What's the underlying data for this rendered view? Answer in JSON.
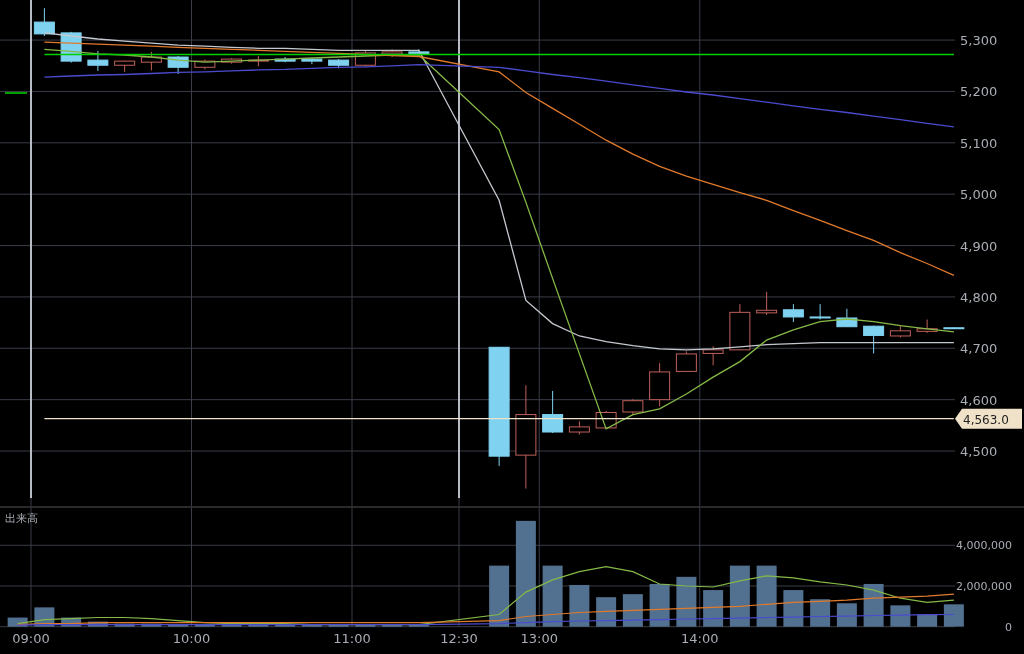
{
  "price_chart": {
    "marker": {
      "color": "#00a000"
    },
    "current_price": {
      "label": "4,563.0",
      "color": "#f0e2c8"
    },
    "chart_data": {
      "type": "candlestick",
      "grid": true,
      "ylim": [
        4393,
        5378
      ],
      "yticks": [
        {
          "value": 4500,
          "label": "4,500"
        },
        {
          "value": 4600,
          "label": "4,600"
        },
        {
          "value": 4700,
          "label": "4,700"
        },
        {
          "value": 4800,
          "label": "4,800"
        },
        {
          "value": 4900,
          "label": "4,900"
        },
        {
          "value": 5000,
          "label": "5,000"
        },
        {
          "value": 5100,
          "label": "5,100"
        },
        {
          "value": 5200,
          "label": "5,200"
        },
        {
          "value": 5300,
          "label": "5,300"
        }
      ],
      "ohlc": [
        [
          5335,
          5362,
          5308,
          5312
        ],
        [
          5314,
          5316,
          5256,
          5259
        ],
        [
          5261,
          5279,
          5240,
          5251
        ],
        [
          5251,
          5260,
          5238,
          5259
        ],
        [
          5257,
          5277,
          5241,
          5267
        ],
        [
          5267,
          5269,
          5234,
          5247
        ],
        [
          5247,
          5262,
          5243,
          5259
        ],
        [
          5257,
          5265,
          5254,
          5263
        ],
        [
          5259,
          5269,
          5249,
          5261
        ],
        [
          5263,
          5267,
          5257,
          5259
        ],
        [
          5263,
          5265,
          5253,
          5259
        ],
        [
          5261,
          5263,
          5245,
          5251
        ],
        [
          5251,
          5280,
          5249,
          5275
        ],
        [
          5273,
          5282,
          5267,
          5277
        ],
        [
          5277,
          5282,
          5270,
          5273
        ],
        null,
        null,
        [
          4702,
          4702,
          4471,
          4490
        ],
        [
          4492,
          4628,
          4427,
          4571
        ],
        [
          4571,
          4617,
          4535,
          4537
        ],
        [
          4537,
          4558,
          4532,
          4547
        ],
        [
          4545,
          4578,
          4544,
          4575
        ],
        [
          4576,
          4601,
          4570,
          4598
        ],
        [
          4600,
          4671,
          4587,
          4654
        ],
        [
          4655,
          4694,
          4655,
          4689
        ],
        [
          4690,
          4704,
          4667,
          4697
        ],
        [
          4697,
          4786,
          4696,
          4770
        ],
        [
          4769,
          4810,
          4765,
          4774
        ],
        [
          4775,
          4786,
          4751,
          4761
        ],
        [
          4761,
          4786,
          4756,
          4759
        ],
        [
          4759,
          4777,
          4742,
          4742
        ],
        [
          4743,
          4744,
          4690,
          4725
        ],
        [
          4724,
          4743,
          4721,
          4734
        ],
        [
          4733,
          4756,
          4730,
          4738
        ],
        [
          4740,
          4741,
          4739,
          4739
        ]
      ],
      "series": [
        {
          "type": "line",
          "color": "#c4c8cf",
          "values": [
            5314,
            5308,
            5302,
            5298,
            5294,
            5290,
            5288,
            5286,
            5284,
            5284,
            5282,
            5280,
            5280,
            5280,
            5280,
            null,
            null,
            4988,
            4793,
            4748,
            4724,
            4713,
            4705,
            4699,
            4697,
            4699,
            4703,
            4707,
            4709,
            4711,
            4711,
            4711,
            4711,
            4711,
            4711
          ]
        },
        {
          "type": "line",
          "color": "#86b947",
          "values": [
            5282,
            5278,
            5273,
            5271,
            5267,
            5261,
            5257,
            5259,
            5261,
            5263,
            5265,
            5267,
            5269,
            5271,
            5271,
            null,
            null,
            5126,
            4984,
            4836,
            4689,
            4543,
            4571,
            4582,
            4611,
            4644,
            4674,
            4716,
            4736,
            4752,
            4757,
            4752,
            4744,
            4738,
            4732
          ]
        },
        {
          "type": "line",
          "color": "#e07a2c",
          "values": [
            5296,
            5294,
            5292,
            5290,
            5288,
            5286,
            5284,
            5282,
            5280,
            5278,
            5276,
            5274,
            5272,
            5270,
            5268,
            null,
            null,
            5238,
            5198,
            5167,
            5136,
            5105,
            5078,
            5054,
            5035,
            5019,
            5003,
            4988,
            4968,
            4949,
            4929,
            4910,
            4886,
            4865,
            4842
          ]
        },
        {
          "type": "line",
          "color": "#4b4bd0",
          "values": [
            5228,
            5230,
            5232,
            5233,
            5235,
            5237,
            5238,
            5240,
            5242,
            5243,
            5245,
            5247,
            5248,
            5250,
            5252,
            null,
            null,
            5247,
            5240,
            5233,
            5227,
            5220,
            5213,
            5206,
            5199,
            5193,
            5186,
            5179,
            5172,
            5165,
            5159,
            5152,
            5145,
            5138,
            5131
          ]
        },
        {
          "type": "line",
          "color": "#00d000",
          "values": [
            5272,
            5272,
            5272,
            5272,
            5272,
            5272,
            5272,
            5272,
            5272,
            5272,
            5272,
            5272,
            5272,
            5272,
            5272,
            5272,
            5272,
            5272,
            5272,
            5272,
            5272,
            5272,
            5272,
            5272,
            5272,
            5272,
            5272,
            5272,
            5272,
            5272,
            5272,
            5272,
            5272,
            5272,
            5272
          ]
        },
        {
          "type": "line",
          "color": "#f0e2c8",
          "values": [
            4563,
            4563,
            4563,
            4563,
            4563,
            4563,
            4563,
            4563,
            4563,
            4563,
            4563,
            4563,
            4563,
            4563,
            4563,
            4563,
            4563,
            4563,
            4563,
            4563,
            4563,
            4563,
            4563,
            4563,
            4563,
            4563,
            4563,
            4563,
            4563,
            4563,
            4563,
            4563,
            4563,
            4563,
            4563
          ]
        }
      ]
    }
  },
  "time_axis": [
    {
      "label": "09:00"
    },
    {
      "label": "10:00"
    },
    {
      "label": "11:00"
    },
    {
      "label": "12:30"
    },
    {
      "label": "13:00"
    },
    {
      "label": "14:00"
    }
  ],
  "volume_chart": {
    "chart_data": {
      "type": "bar",
      "grid": true,
      "title": "出来高",
      "ylim": [
        0,
        5930000
      ],
      "yticks": [
        {
          "value": 0,
          "label": "0"
        },
        {
          "value": 2000000,
          "label": "2,000,000"
        },
        {
          "value": 4000000,
          "label": "4,000,000"
        }
      ],
      "series": [
        {
          "color": "#52708f",
          "values": [
            450000,
            950000,
            450000,
            250000,
            150000,
            150000,
            100000,
            100000,
            100000,
            100000,
            100000,
            100000,
            100000,
            100000,
            100000,
            100000,
            null,
            null,
            3000000,
            5200000,
            3000000,
            2050000,
            1450000,
            1600000,
            2100000,
            2450000,
            1800000,
            3000000,
            3000000,
            1800000,
            1350000,
            1150000,
            2100000,
            1050000,
            600000,
            1100000
          ]
        },
        {
          "type": "line",
          "color": "#86b947",
          "values": [
            150000,
            350000,
            400000,
            450000,
            450000,
            400000,
            300000,
            200000,
            150000,
            150000,
            150000,
            100000,
            100000,
            100000,
            100000,
            100000,
            null,
            null,
            600000,
            1700000,
            2300000,
            2700000,
            2950000,
            2700000,
            2100000,
            2000000,
            1950000,
            2250000,
            2500000,
            2400000,
            2200000,
            2050000,
            1800000,
            1400000,
            1200000,
            1300000
          ]
        },
        {
          "type": "line",
          "color": "#e07a2c",
          "values": [
            100000,
            150000,
            150000,
            200000,
            200000,
            200000,
            200000,
            200000,
            200000,
            200000,
            200000,
            200000,
            200000,
            200000,
            200000,
            200000,
            null,
            null,
            300000,
            500000,
            600000,
            700000,
            750000,
            800000,
            850000,
            900000,
            950000,
            1000000,
            1100000,
            1200000,
            1250000,
            1300000,
            1400000,
            1450000,
            1500000,
            1600000
          ]
        },
        {
          "type": "line",
          "color": "#4b4bd0",
          "values": [
            80000,
            100000,
            100000,
            100000,
            100000,
            100000,
            100000,
            100000,
            100000,
            100000,
            100000,
            100000,
            100000,
            100000,
            100000,
            100000,
            null,
            null,
            150000,
            200000,
            250000,
            280000,
            300000,
            320000,
            350000,
            380000,
            400000,
            420000,
            450000,
            470000,
            500000,
            520000,
            550000,
            570000,
            590000,
            600000
          ]
        }
      ]
    }
  }
}
